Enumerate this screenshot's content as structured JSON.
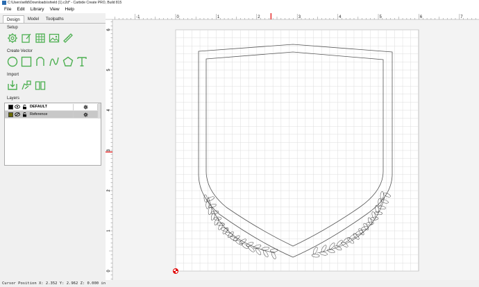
{
  "window": {
    "title": "C:\\Users\\willd\\Downloads\\shield (1).c2d* - Carbide Create PRO, Build 815"
  },
  "menu": [
    "File",
    "Edit",
    "Library",
    "View",
    "Help"
  ],
  "tabs": [
    {
      "label": "Design",
      "active": true
    },
    {
      "label": "Model",
      "active": false
    },
    {
      "label": "Toolpaths",
      "active": false
    }
  ],
  "sections": {
    "setup": "Setup",
    "create_vector": "Create Vector",
    "import": "Import",
    "layers": "Layers"
  },
  "setup_tools": [
    "gear-icon",
    "edit-icon",
    "grid-icon",
    "image-icon",
    "ruler-icon"
  ],
  "vector_tools": [
    "circle-icon",
    "rectangle-icon",
    "polygon-icon",
    "curve-icon",
    "pentagon-icon",
    "text-icon"
  ],
  "import_tools": [
    "import-icon",
    "import-vector-icon",
    "library-icon"
  ],
  "layers": [
    {
      "name": "DEFAULT",
      "color": "#000000",
      "bold": true,
      "selected": false
    },
    {
      "name": "Reference",
      "color": "#6b6b00",
      "bold": false,
      "selected": true
    }
  ],
  "ruler": {
    "x_labels": [
      "-1",
      "0",
      "1",
      "2",
      "3",
      "4",
      "5",
      "6",
      "7"
    ],
    "y_labels": [
      "0",
      "1",
      "2",
      "3",
      "4",
      "5",
      "6"
    ],
    "cursor_x_value": 2.352,
    "cursor_y_value": 2.962
  },
  "status": {
    "text": "Cursor Position X: 2.352 Y: 2.962 Z: 0.000 in"
  },
  "colors": {
    "accent_green": "#4caf50",
    "cursor_red": "#e00000",
    "grid": "#d9d9d9"
  }
}
